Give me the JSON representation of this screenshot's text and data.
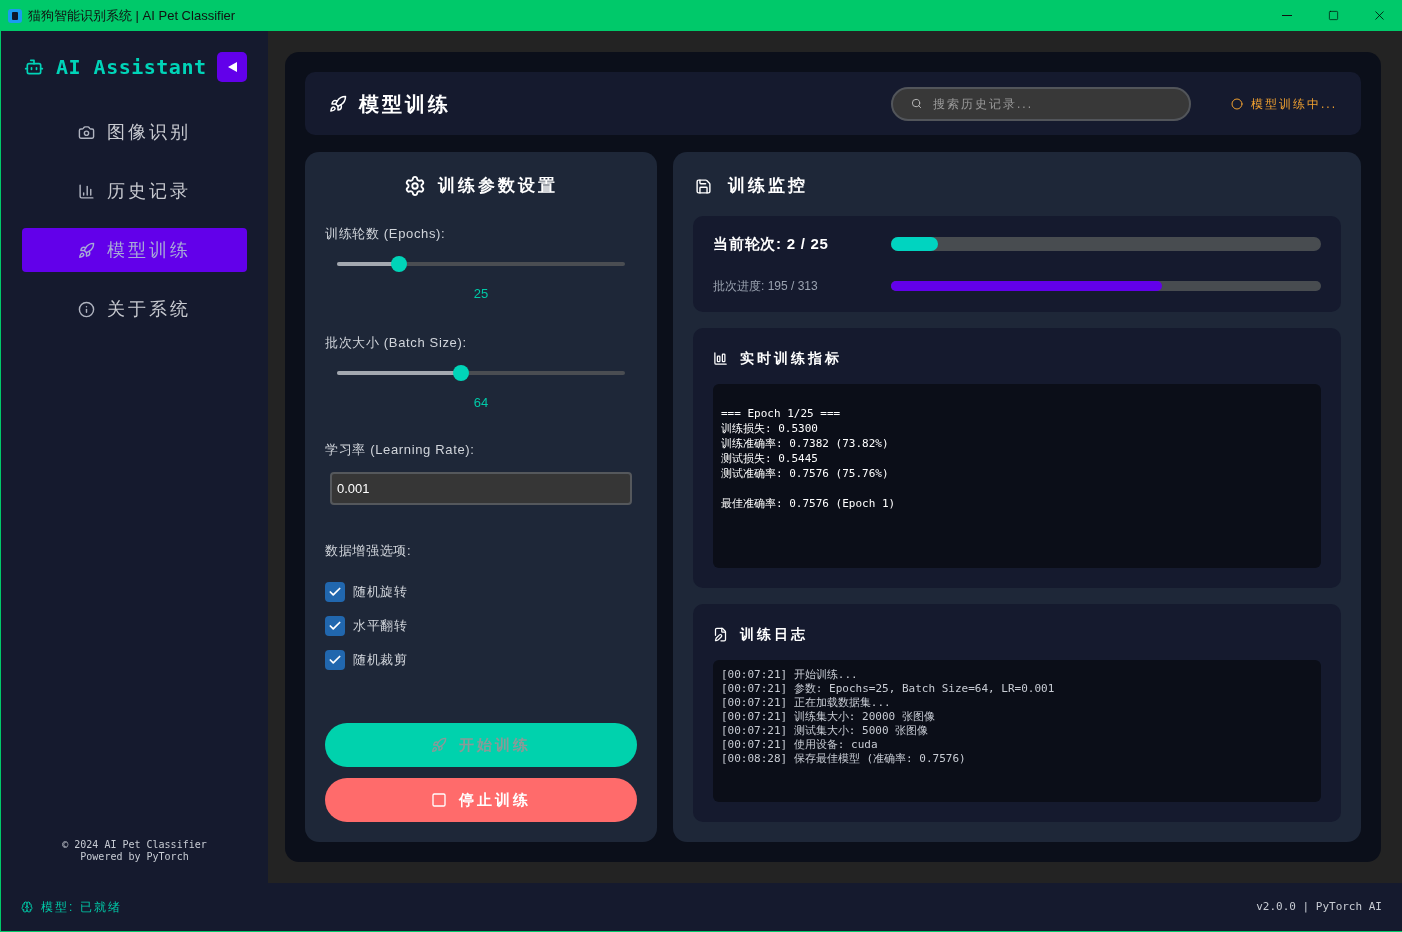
{
  "window": {
    "title": "猫狗智能识别系统 | AI Pet Classifier"
  },
  "sidebar": {
    "brand": "AI Assistant",
    "items": [
      {
        "label": "图像识别",
        "selected": false
      },
      {
        "label": "历史记录",
        "selected": false
      },
      {
        "label": "模型训练",
        "selected": true
      },
      {
        "label": "关于系统",
        "selected": false
      }
    ],
    "footer": [
      "© 2024 AI Pet Classifier",
      "Powered by PyTorch"
    ]
  },
  "header": {
    "title": "模型训练",
    "search": {
      "placeholder": "搜索历史记录..."
    },
    "status": "模型训练中..."
  },
  "params": {
    "title": "训练参数设置",
    "sliders": [
      {
        "label": "训练轮数 (Epochs):",
        "level": 0.215,
        "value": "25"
      },
      {
        "label": "批次大小 (Batch Size):",
        "level": 0.43,
        "value": "64"
      }
    ],
    "learning_rate": {
      "label": "学习率 (Learning Rate):",
      "value": "0.001"
    },
    "augmentation": {
      "label": "数据增强选项:",
      "options": [
        {
          "label": "随机旋转",
          "checked": true
        },
        {
          "label": "水平翻转",
          "checked": true
        },
        {
          "label": "随机裁剪",
          "checked": true
        }
      ]
    },
    "buttons": [
      {
        "label": "开始训练",
        "kind": "start",
        "disabled": true
      },
      {
        "label": "停止训练",
        "kind": "stop",
        "disabled": false
      }
    ]
  },
  "monitor": {
    "title": "训练监控",
    "epoch": {
      "label": "当前轮次: 2 / 25",
      "level": 0.11
    },
    "batch": {
      "label": "批次进度: 195 / 313",
      "level": 0.63
    },
    "metrics": {
      "title": "实时训练指标",
      "text": "=== Epoch 1/25 ===\n训练损失: 0.5300\n训练准确率: 0.7382 (73.82%)\n测试损失: 0.5445\n测试准确率: 0.7576 (75.76%)\n\n最佳准确率: 0.7576 (Epoch 1)"
    },
    "log": {
      "title": "训练日志",
      "lines": [
        "[00:07:21] 开始训练...",
        "[00:07:21] 参数: Epochs=25, Batch Size=64, LR=0.001",
        "[00:07:21] 正在加载数据集...",
        "[00:07:21] 训练集大小: 20000 张图像",
        "[00:07:21] 测试集大小: 5000 张图像",
        "[00:07:21] 使用设备: cuda",
        "[00:08:28] 保存最佳模型 (准确率: 0.7576)"
      ]
    }
  },
  "status_bar": {
    "model": "模型: 已就绪",
    "version": "v2.0.0 | PyTorch AI"
  }
}
